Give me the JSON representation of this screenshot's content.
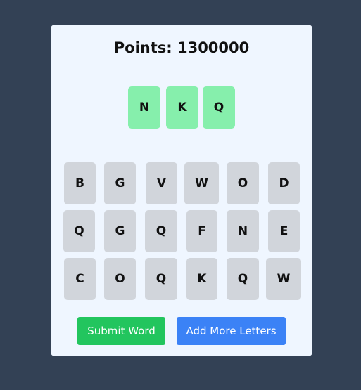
{
  "points_label": "Points: 1300000",
  "colors": {
    "background": "#334155",
    "card": "#eff6ff",
    "selected_tile": "#86efac",
    "pool_tile": "#d1d5db",
    "submit_button": "#22c55e",
    "add_letters_button": "#3b82f6"
  },
  "selected_letters": [
    "N",
    "K",
    "Q"
  ],
  "letter_pool": [
    [
      "B",
      "G",
      "V",
      "W",
      "O",
      "D"
    ],
    [
      "Q",
      "G",
      "Q",
      "F",
      "N",
      "E"
    ],
    [
      "C",
      "O",
      "Q",
      "K",
      "Q",
      "W"
    ]
  ],
  "buttons": {
    "submit": "Submit Word",
    "add_letters": "Add More Letters"
  }
}
